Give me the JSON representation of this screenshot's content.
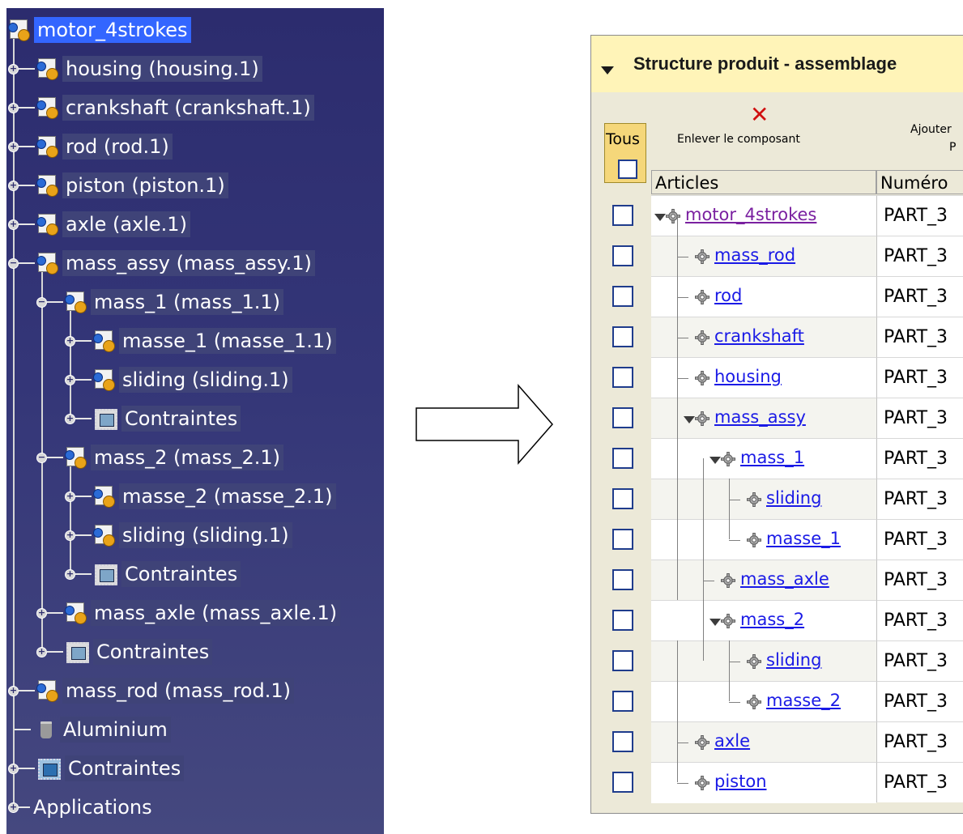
{
  "tree": {
    "root": "motor_4strokes",
    "items": [
      {
        "label": "housing (housing.1)"
      },
      {
        "label": "crankshaft (crankshaft.1)"
      },
      {
        "label": "rod (rod.1)"
      },
      {
        "label": "piston (piston.1)"
      },
      {
        "label": "axle (axle.1)"
      },
      {
        "label": "mass_assy (mass_assy.1)"
      },
      {
        "label": "mass_1 (mass_1.1)"
      },
      {
        "label": "masse_1 (masse_1.1)"
      },
      {
        "label": "sliding (sliding.1)"
      },
      {
        "label": "Contraintes"
      },
      {
        "label": "mass_2 (mass_2.1)"
      },
      {
        "label": "masse_2 (masse_2.1)"
      },
      {
        "label": "sliding (sliding.1)"
      },
      {
        "label": "Contraintes"
      },
      {
        "label": "mass_axle (mass_axle.1)"
      },
      {
        "label": "Contraintes"
      },
      {
        "label": "mass_rod (mass_rod.1)"
      },
      {
        "label": "Aluminium"
      },
      {
        "label": "Contraintes"
      },
      {
        "label": "Applications"
      }
    ]
  },
  "panel": {
    "title": "Structure produit - assemblage",
    "remove_label": "Enlever le composant",
    "add_label": "Ajouter",
    "add_label_2": "P",
    "tous_label": "Tous",
    "col_articles": "Articles",
    "col_numero": "Numéro",
    "rows": [
      {
        "name": "motor_4strokes",
        "numero": "PART_3"
      },
      {
        "name": "mass_rod",
        "numero": "PART_3"
      },
      {
        "name": "rod",
        "numero": "PART_3"
      },
      {
        "name": "crankshaft",
        "numero": "PART_3"
      },
      {
        "name": "housing",
        "numero": "PART_3"
      },
      {
        "name": "mass_assy",
        "numero": "PART_3"
      },
      {
        "name": "mass_1",
        "numero": "PART_3"
      },
      {
        "name": "sliding",
        "numero": "PART_3"
      },
      {
        "name": "masse_1",
        "numero": "PART_3"
      },
      {
        "name": "mass_axle",
        "numero": "PART_3"
      },
      {
        "name": "mass_2",
        "numero": "PART_3"
      },
      {
        "name": "sliding",
        "numero": "PART_3"
      },
      {
        "name": "masse_2",
        "numero": "PART_3"
      },
      {
        "name": "axle",
        "numero": "PART_3"
      },
      {
        "name": "piston",
        "numero": "PART_3"
      }
    ]
  }
}
